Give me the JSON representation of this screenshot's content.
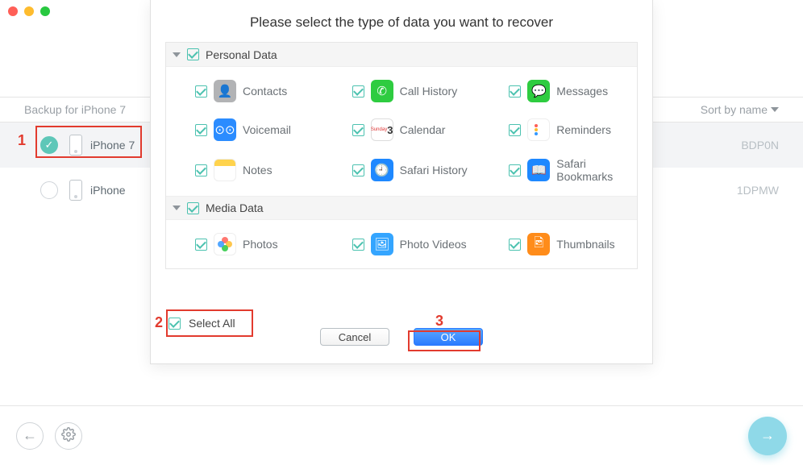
{
  "traffic": {
    "close": "close",
    "min": "minimize",
    "max": "maximize"
  },
  "list": {
    "header_label": "Backup for iPhone 7",
    "sort_label": "Sort by name",
    "devices": [
      {
        "name": "iPhone 7",
        "serial_tail": "BDP0N",
        "selected": true
      },
      {
        "name": "iPhone",
        "serial_tail": "1DPMW",
        "selected": false
      }
    ]
  },
  "steps": {
    "one": "1",
    "two": "2",
    "three": "3"
  },
  "modal": {
    "title": "Please select the type of data you want to recover",
    "sections": [
      {
        "title": "Personal Data",
        "items": [
          {
            "key": "contacts",
            "label": "Contacts"
          },
          {
            "key": "call_history",
            "label": "Call History"
          },
          {
            "key": "messages",
            "label": "Messages"
          },
          {
            "key": "voicemail",
            "label": "Voicemail"
          },
          {
            "key": "calendar",
            "label": "Calendar",
            "day": "3",
            "wk": "Sunday"
          },
          {
            "key": "reminders",
            "label": "Reminders"
          },
          {
            "key": "notes",
            "label": "Notes"
          },
          {
            "key": "safari_history",
            "label": "Safari History"
          },
          {
            "key": "safari_bookmarks",
            "label": "Safari Bookmarks"
          }
        ]
      },
      {
        "title": "Media Data",
        "items": [
          {
            "key": "photos",
            "label": "Photos"
          },
          {
            "key": "photo_videos",
            "label": "Photo Videos"
          },
          {
            "key": "thumbnails",
            "label": "Thumbnails"
          }
        ]
      }
    ],
    "select_all": "Select All",
    "cancel": "Cancel",
    "ok": "OK"
  }
}
